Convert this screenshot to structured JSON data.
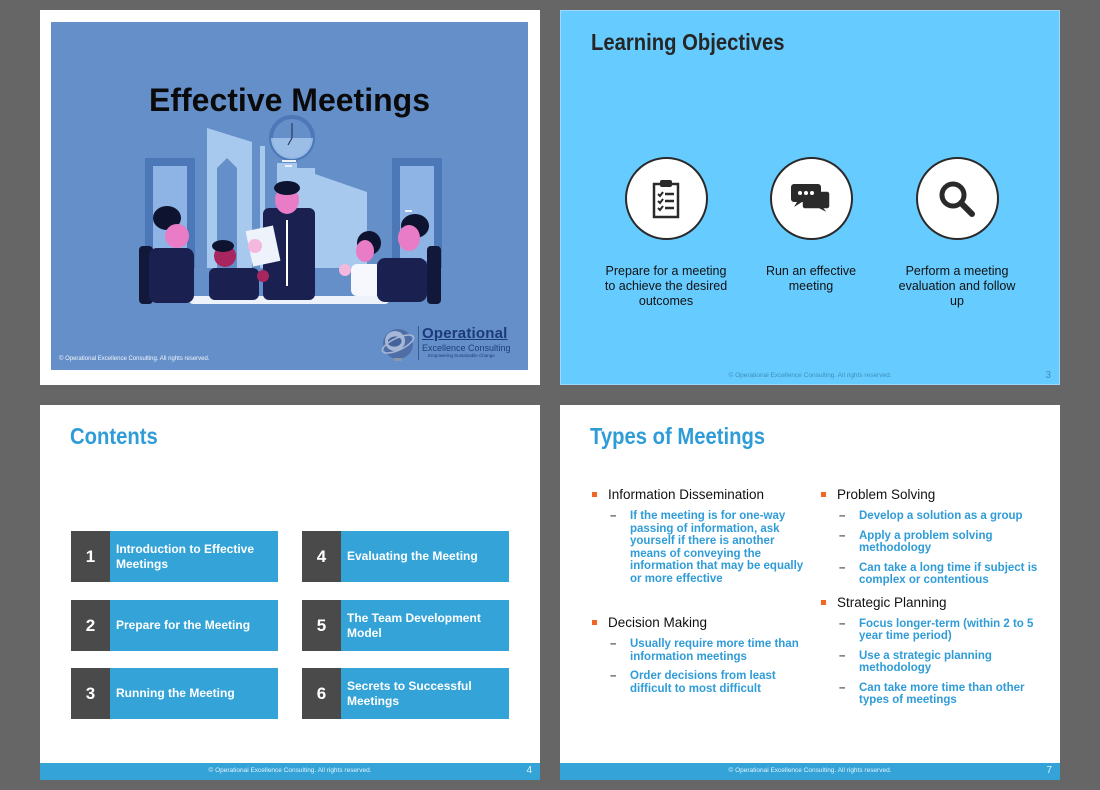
{
  "colors": {
    "viewer_bg": "#666666",
    "slide1_bg": "#658fc9",
    "slide2_bg": "#66ccff",
    "accent_blue": "#33a3d8",
    "title_blue": "#2f9cd8",
    "number_block": "#4a4a4a",
    "bullet_orange": "#f26522"
  },
  "slides": [
    {
      "title": "Effective Meetings",
      "copyright": "© Operational Excellence Consulting.  All rights reserved.",
      "logo": {
        "name": "Operational",
        "subtitle": "Excellence Consulting",
        "tagline": "Empowering Sustainable Change"
      },
      "illustration": "meeting-illustration"
    },
    {
      "title": "Learning Objectives",
      "objectives": [
        {
          "icon": "clipboard-checklist-icon",
          "label": "Prepare for a meeting to achieve the desired outcomes"
        },
        {
          "icon": "chat-bubbles-icon",
          "label": "Run an effective meeting"
        },
        {
          "icon": "magnifier-icon",
          "label": "Perform a meeting evaluation and follow up"
        }
      ],
      "footer": "© Operational Excellence Consulting.  All rights reserved.",
      "page": "3"
    },
    {
      "title": "Contents",
      "items": [
        {
          "num": "1",
          "label": "Introduction to Effective Meetings"
        },
        {
          "num": "2",
          "label": "Prepare for the Meeting"
        },
        {
          "num": "3",
          "label": "Running the Meeting"
        },
        {
          "num": "4",
          "label": "Evaluating the Meeting"
        },
        {
          "num": "5",
          "label": "The Team Development Model"
        },
        {
          "num": "6",
          "label": "Secrets to Successful Meetings"
        }
      ],
      "footer": "© Operational Excellence Consulting.  All rights reserved.",
      "page": "4"
    },
    {
      "title": "Types of Meetings",
      "left": [
        {
          "heading": "Information Dissemination",
          "subs": [
            "If the meeting is for one-way passing of information, ask yourself if there is another means of conveying the information that may be equally or more effective"
          ]
        },
        {
          "heading": "Decision Making",
          "subs": [
            "Usually require more time than information meetings",
            "Order decisions from least difficult to most difficult"
          ]
        }
      ],
      "right": [
        {
          "heading": "Problem Solving",
          "subs": [
            "Develop a solution as a group",
            "Apply a problem solving methodology",
            "Can take a long time if subject is complex or contentious"
          ]
        },
        {
          "heading": "Strategic Planning",
          "subs": [
            "Focus longer-term (within 2 to 5 year time period)",
            "Use a strategic planning methodology",
            "Can take more time than other types of meetings"
          ]
        }
      ],
      "footer": "© Operational Excellence Consulting.  All rights reserved.",
      "page": "7"
    }
  ]
}
